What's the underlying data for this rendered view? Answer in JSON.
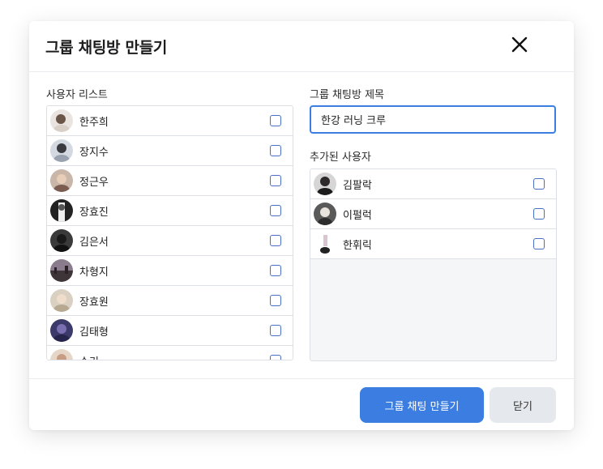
{
  "modal": {
    "title": "그룹 채팅방 만들기",
    "close_icon": "close-icon"
  },
  "user_list": {
    "label": "사용자 리스트",
    "users": [
      {
        "name": "한주희",
        "avatar": "avatar-photo",
        "checked": false
      },
      {
        "name": "장지수",
        "avatar": "avatar-photo",
        "checked": false
      },
      {
        "name": "정근우",
        "avatar": "avatar-photo",
        "checked": false
      },
      {
        "name": "장효진",
        "avatar": "avatar-photo",
        "checked": false
      },
      {
        "name": "김은서",
        "avatar": "avatar-photo",
        "checked": false
      },
      {
        "name": "차형지",
        "avatar": "avatar-photo",
        "checked": false
      },
      {
        "name": "장효원",
        "avatar": "avatar-photo",
        "checked": false
      },
      {
        "name": "김태형",
        "avatar": "avatar-photo",
        "checked": false
      },
      {
        "name": "슈기",
        "avatar": "avatar-photo",
        "checked": false
      }
    ]
  },
  "chat_title": {
    "label": "그룹 채팅방 제목",
    "value": "한강 러닝 크루",
    "placeholder": ""
  },
  "added_users": {
    "label": "추가된 사용자",
    "users": [
      {
        "name": "김팔락",
        "avatar": "avatar-photo",
        "checked": false
      },
      {
        "name": "이펄럭",
        "avatar": "avatar-photo",
        "checked": false
      },
      {
        "name": "한휘릭",
        "avatar": "avatar-photo",
        "checked": false
      }
    ]
  },
  "footer": {
    "create_label": "그룹 채팅 만들기",
    "close_label": "닫기"
  },
  "colors": {
    "accent": "#3b7de0",
    "secondary_button": "#e5e8ec",
    "border": "#dcdfe4",
    "checkbox_border": "#4a6fc7",
    "panel_bg": "#f5f6f8"
  }
}
